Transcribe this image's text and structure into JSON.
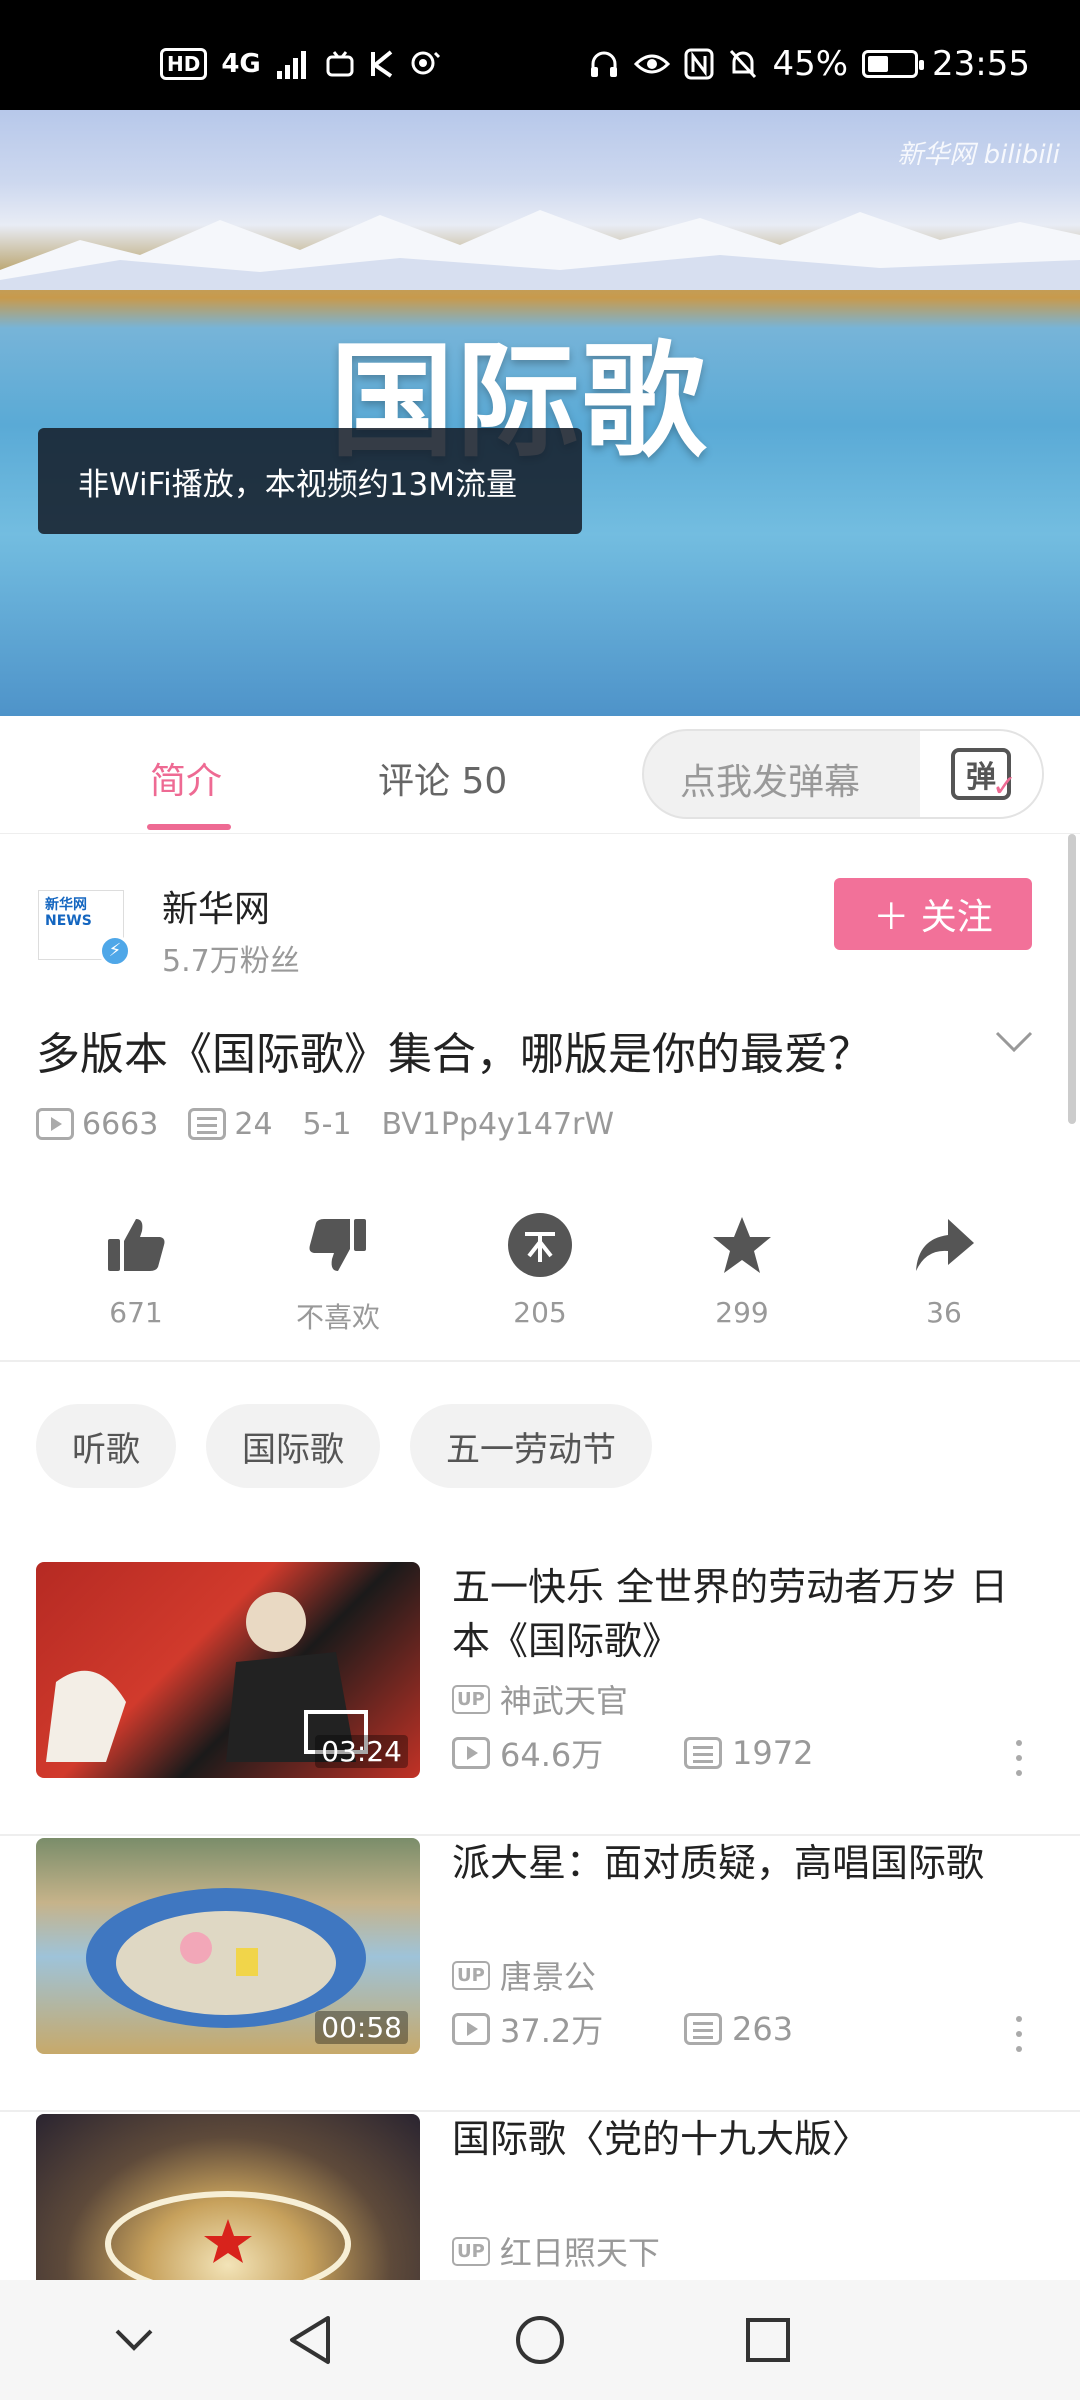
{
  "status_bar": {
    "hd": "HD",
    "network": "4G",
    "battery_pct": "45%",
    "battery_level": 0.45,
    "time": "23:55"
  },
  "video": {
    "watermark": "新华网 bilibili",
    "overlay_title": "国际歌",
    "toast": "非WiFi播放，本视频约13M流量"
  },
  "tabs": [
    {
      "label": "简介",
      "active": true
    },
    {
      "label": "评论 50",
      "active": false
    }
  ],
  "danmu": {
    "placeholder": "点我发弹幕",
    "button_glyph": "弹"
  },
  "uploader": {
    "name": "新华网",
    "fans": "5.7万粉丝",
    "avatar_text": "新华网 NEWS",
    "follow_label": "＋ 关注"
  },
  "video_info": {
    "title": "多版本《国际歌》集合，哪版是你的最爱？",
    "views": "6663",
    "danmaku": "24",
    "date": "5-1",
    "bvid": "BV1Pp4y147rW"
  },
  "actions": [
    {
      "icon": "thumbs-up-icon",
      "label": "671"
    },
    {
      "icon": "thumbs-down-icon",
      "label": "不喜欢"
    },
    {
      "icon": "coin-icon",
      "label": "205"
    },
    {
      "icon": "star-icon",
      "label": "299"
    },
    {
      "icon": "share-icon",
      "label": "36"
    }
  ],
  "tags": [
    "听歌",
    "国际歌",
    "五一劳动节"
  ],
  "related": [
    {
      "title": "五一快乐 全世界的劳动者万岁 日本《国际歌》",
      "duration": "03:24",
      "uploader": "神武天官",
      "views": "64.6万",
      "danmaku": "1972"
    },
    {
      "title": "派大星：面对质疑，高唱国际歌",
      "duration": "00:58",
      "uploader": "唐景公",
      "views": "37.2万",
      "danmaku": "263"
    },
    {
      "title": "国际歌〈党的十九大版〉",
      "duration": "",
      "uploader": "红日照天下",
      "views": "",
      "danmaku": ""
    }
  ],
  "up_badge": "UP",
  "colors": {
    "accent": "#f27199",
    "tab_active": "#ee6a93",
    "icon_gray": "#555555",
    "text_gray": "#999999"
  }
}
